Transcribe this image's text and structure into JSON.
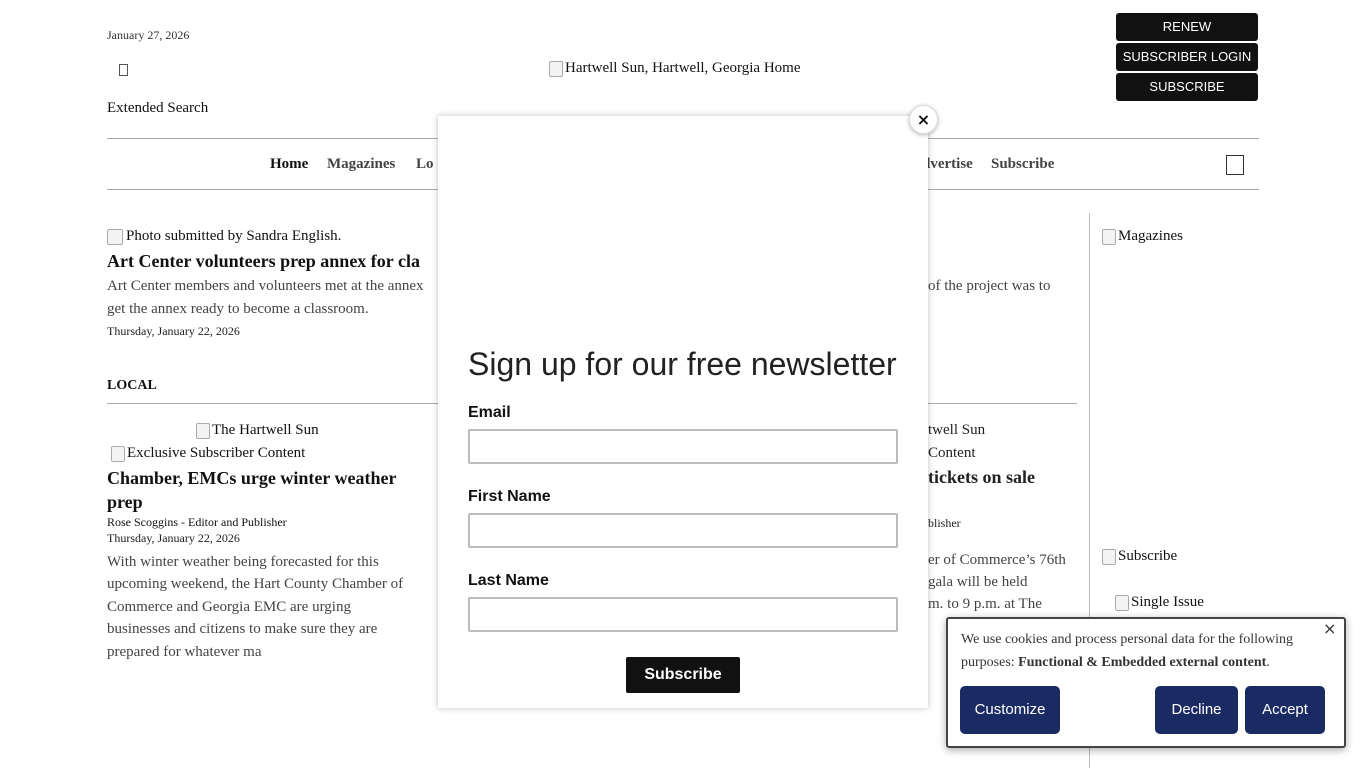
{
  "header": {
    "date": "January 27, 2026",
    "extended_search": "Extended Search",
    "logo_alt": "Hartwell Sun, Hartwell, Georgia Home",
    "buttons": [
      "RENEW",
      "SUBSCRIBER LOGIN",
      "SUBSCRIBE"
    ]
  },
  "nav": {
    "items": [
      "Home",
      "Magazines",
      "Lo",
      "dvertise",
      "Subscribe"
    ]
  },
  "featured": {
    "photo_caption": "Photo submitted by Sandra English.",
    "headline": "Art Center volunteers prep annex for cla",
    "summary_line1": "Art Center members and volunteers met at the annex",
    "summary_right": "of the project was to",
    "summary_line2": "get the annex ready to become a classroom.",
    "date": "Thursday, January 22, 2026"
  },
  "local": {
    "label": "LOCAL",
    "article1": {
      "image_alt": "The Hartwell Sun",
      "badge_alt": "Exclusive Subscriber Content",
      "headline": "Chamber, EMCs urge winter weather prep",
      "author": "Rose Scoggins - Editor and Publisher",
      "date": "Thursday, January 22, 2026",
      "summary": "With winter weather being forecasted for this upcoming weekend, the Hart County Chamber of Commerce and Georgia EMC are urging businesses and citizens to make sure they are prepared for whatever ma"
    },
    "article2_fragments": {
      "image_alt": "twell Sun",
      "badge_alt": "Content",
      "headline": "tickets on sale",
      "author": "blisher",
      "line1": "er of Commerce’s 76th",
      "line2": "gala will be held",
      "line3": "m. to 9 p.m. at The"
    }
  },
  "sidebar": {
    "magazines_alt": "Magazines",
    "subscribe_alt": "Subscribe",
    "single_issue_alt": "Single Issue"
  },
  "newsletter_modal": {
    "close": "×",
    "title": "Sign up for our free newsletter",
    "email_label": "Email",
    "first_name_label": "First Name",
    "last_name_label": "Last Name",
    "submit_label": "Subscribe"
  },
  "cookie_banner": {
    "text_prefix": "We use cookies and process personal data for the following purposes: ",
    "text_bold": "Functional & Embedded external content",
    "text_suffix": ".",
    "close": "×",
    "customize_label": "Customize",
    "decline_label": "Decline",
    "accept_label": "Accept",
    "button_color": "#1a2b63"
  }
}
